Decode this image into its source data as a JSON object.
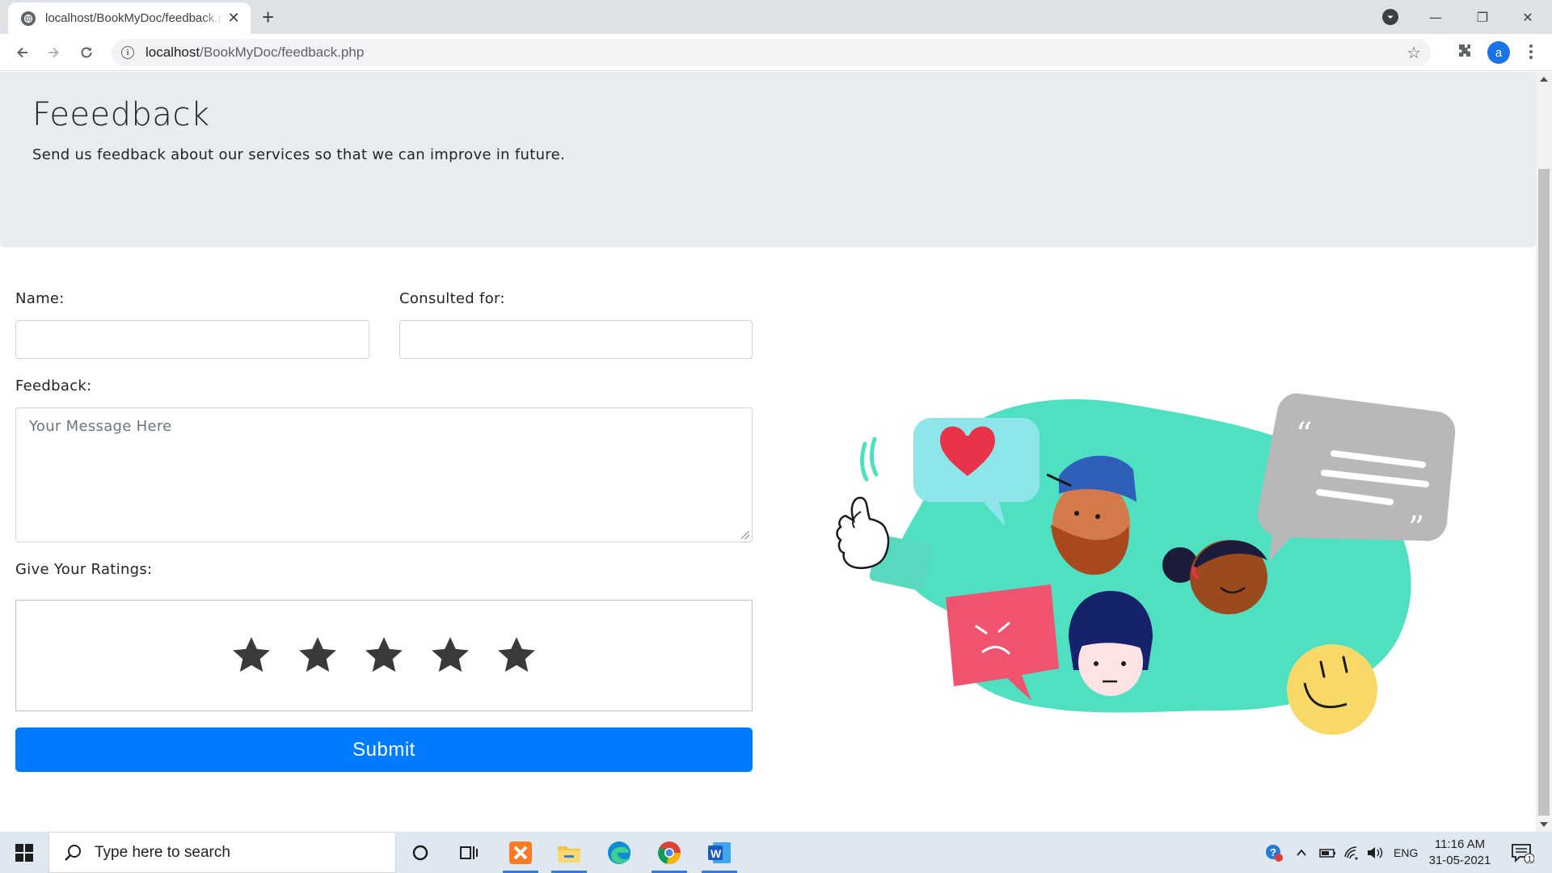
{
  "browser": {
    "tab_title": "localhost/BookMyDoc/feedback.php",
    "tab_close": "✕",
    "new_tab": "+",
    "url_host": "localhost",
    "url_path": "/BookMyDoc/feedback.php",
    "profile_initial": "a",
    "window_controls": {
      "minimize": "—",
      "maximize": "❐",
      "close": "✕"
    }
  },
  "page": {
    "title": "Feeedback",
    "subtitle": "Send us feedback about our services so that we can improve in future."
  },
  "form": {
    "name_label": "Name:",
    "name_value": "",
    "consulted_label": "Consulted for:",
    "consulted_value": "",
    "feedback_label": "Feedback:",
    "feedback_placeholder": "Your Message Here",
    "ratings_label": "Give Your Ratings:",
    "stars_total": 5,
    "stars_selected": 0,
    "submit_label": "Submit"
  },
  "taskbar": {
    "search_placeholder": "Type here to search",
    "language": "ENG",
    "time": "11:16 AM",
    "date": "31-05-2021",
    "notification_count": "1"
  },
  "colors": {
    "primary": "#007bff",
    "jumbotron": "#e9ecef",
    "star": "#3a3a3a",
    "illustration_teal": "#4fe0c2"
  }
}
